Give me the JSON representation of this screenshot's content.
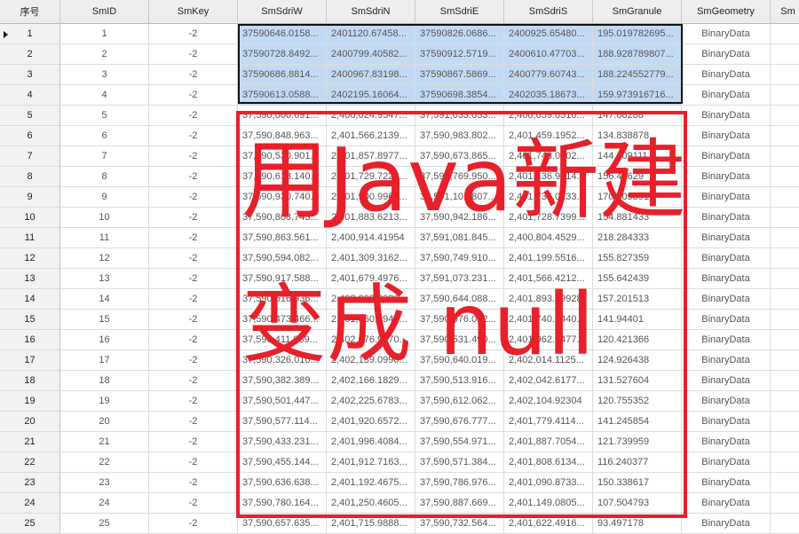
{
  "columns": [
    "序号",
    "SmID",
    "SmKey",
    "SmSdriW",
    "SmSdriN",
    "SmSdriE",
    "SmSdriS",
    "SmGranule",
    "SmGeometry",
    "Sm"
  ],
  "rows": [
    [
      "1",
      "1",
      "-2",
      "37590646.0158...",
      "2401120.67458...",
      "37590826.0686...",
      "2400925.65480...",
      "195.019782695...",
      "BinaryData"
    ],
    [
      "2",
      "2",
      "-2",
      "37590728.8492...",
      "2400799.40582...",
      "37590912.5719...",
      "2400610.47703...",
      "188.928789807...",
      "BinaryData"
    ],
    [
      "3",
      "3",
      "-2",
      "37590686.8814...",
      "2400967.83198...",
      "37590867.5869...",
      "2400779.60743...",
      "188.224552779...",
      "BinaryData"
    ],
    [
      "4",
      "4",
      "-2",
      "37590613.0588...",
      "2402195.16064...",
      "37590698.3854...",
      "2402035.18673...",
      "159.973916716...",
      "BinaryData"
    ],
    [
      "5",
      "5",
      "-2",
      "37,590,006.691...",
      "2,400,024.9547...",
      "37,591,033.033...",
      "2,400,059.0310...",
      "147.68288",
      "BinaryData"
    ],
    [
      "6",
      "6",
      "-2",
      "37,590,848.963...",
      "2,401,566.2139...",
      "37,590,983.802...",
      "2,401,459.1952...",
      "134.838878",
      "BinaryData"
    ],
    [
      "7",
      "7",
      "-2",
      "37,590,530.901...",
      "2,401,857.8977...",
      "37,590,673.865...",
      "2,401,743.0802...",
      "144.109111",
      "BinaryData"
    ],
    [
      "8",
      "8",
      "-2",
      "37,590,613.140...",
      "2,401,729.7229...",
      "37,590,769.950...",
      "2,401,136.9014...",
      "156.41629",
      "BinaryData"
    ],
    [
      "9",
      "9",
      "-2",
      "37,590,930.740...",
      "2,401,900.9964...",
      "37,591,101.807...",
      "2,401,736.0133...",
      "170.909391",
      "BinaryData"
    ],
    [
      "10",
      "10",
      "-2",
      "37,590,808.743...",
      "2,401,883.6213...",
      "37,590,942.186...",
      "2,401,728.7399...",
      "154.881433",
      "BinaryData"
    ],
    [
      "11",
      "11",
      "-2",
      "37,590,863.561...",
      "2,400,914.41954",
      "37,591,081.845...",
      "2,400,804.4529...",
      "218.284333",
      "BinaryData"
    ],
    [
      "12",
      "12",
      "-2",
      "37,590,594.082...",
      "2,401,309.3162...",
      "37,590,749.910...",
      "2,401,199.5516...",
      "155.827359",
      "BinaryData"
    ],
    [
      "13",
      "13",
      "-2",
      "37,590,917.588...",
      "2,401,679.4976...",
      "37,591,073.231...",
      "2,401,566.4212...",
      "155.642439",
      "BinaryData"
    ],
    [
      "14",
      "14",
      "-2",
      "37,590,516.936...",
      "2,402,008.3080...",
      "37,590,644.088...",
      "2,401,893.19928",
      "157.201513",
      "BinaryData"
    ],
    [
      "15",
      "15",
      "-2",
      "37,590,473.466...",
      "2,401,860.8944...",
      "37,590,576.012...",
      "2,401,740.0440...",
      "141.94401",
      "BinaryData"
    ],
    [
      "16",
      "16",
      "-2",
      "37,590,411.069...",
      "2,402,076.9470...",
      "37,590,531.490...",
      "2,401,962.8477...",
      "120.421366",
      "BinaryData"
    ],
    [
      "17",
      "17",
      "-2",
      "37,590,326.010...",
      "2,402,139.0990...",
      "37,590,640.019...",
      "2,402,014.1125...",
      "124.926438",
      "BinaryData"
    ],
    [
      "18",
      "18",
      "-2",
      "37,590,382.389...",
      "2,402,166.1829...",
      "37,590,513.916...",
      "2,402,042.6177...",
      "131.527604",
      "BinaryData"
    ],
    [
      "19",
      "19",
      "-2",
      "37,590,501.447...",
      "2,402,225.6783...",
      "37,590,612.062...",
      "2,402,104.92304",
      "120.755352",
      "BinaryData"
    ],
    [
      "20",
      "20",
      "-2",
      "37,590,577.114...",
      "2,401,920.6572...",
      "37,590,676.777...",
      "2,401,779.4114...",
      "141.245854",
      "BinaryData"
    ],
    [
      "21",
      "21",
      "-2",
      "37,590,433.231...",
      "2,401,996.4084...",
      "37,590,554.971...",
      "2,401,887.7054...",
      "121.739959",
      "BinaryData"
    ],
    [
      "22",
      "22",
      "-2",
      "37,590,455.144...",
      "2,401,912.7163...",
      "37,590,571.384...",
      "2,401,808.6134...",
      "116.240377",
      "BinaryData"
    ],
    [
      "23",
      "23",
      "-2",
      "37,590,636.638...",
      "2,401,192.4675...",
      "37,590,786.976...",
      "2,401,090.8733...",
      "150.338617",
      "BinaryData"
    ],
    [
      "24",
      "24",
      "-2",
      "37,590,780.164...",
      "2,401,250.4605...",
      "37,590,887.669...",
      "2,401,149.0805...",
      "107.504793",
      "BinaryData"
    ],
    [
      "25",
      "25",
      "-2",
      "37,590,657.635...",
      "2,401,715.9888...",
      "37,590,732.564...",
      "2,401,622.4916...",
      "93.497178",
      "BinaryData"
    ]
  ],
  "current_row": "1",
  "selected_rows": [
    "1",
    "2",
    "3",
    "4"
  ],
  "annotation": {
    "line1": "用Java新建",
    "line2": "变成 null"
  },
  "colors": {
    "annotation": "#e8202a",
    "selection": "#c3daf5",
    "header": "#eeeeee"
  },
  "icons": {
    "current_row_marker": "triangle-right-icon"
  }
}
